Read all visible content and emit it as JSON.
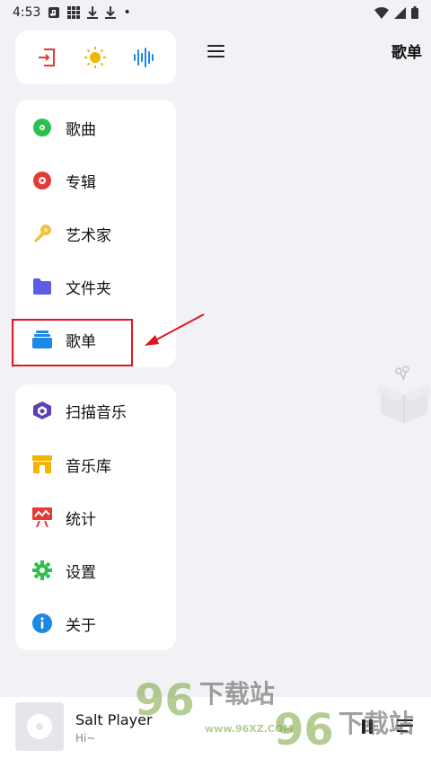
{
  "status_bar": {
    "time": "4:53",
    "dot": "•"
  },
  "quick_actions": [
    {
      "icon": "exit-icon",
      "color": "#e53935"
    },
    {
      "icon": "sun-icon",
      "color": "#f5b400"
    },
    {
      "icon": "waveform-icon",
      "color": "#1e88e5"
    }
  ],
  "nav_group_1": [
    {
      "label": "歌曲",
      "icon": "disc-green-icon",
      "color": "#2fbf4f"
    },
    {
      "label": "专辑",
      "icon": "album-red-icon",
      "color": "#e53935"
    },
    {
      "label": "艺术家",
      "icon": "microphone-icon",
      "color": "#f5c042"
    },
    {
      "label": "文件夹",
      "icon": "folder-icon",
      "color": "#5e5ce6"
    },
    {
      "label": "歌单",
      "icon": "playlist-stack-icon",
      "color": "#1e88e5"
    }
  ],
  "nav_group_2": [
    {
      "label": "扫描音乐",
      "icon": "scan-cube-icon",
      "color": "#5e3fb6"
    },
    {
      "label": "音乐库",
      "icon": "store-icon",
      "color": "#f5b400"
    },
    {
      "label": "统计",
      "icon": "chart-easel-icon",
      "color": "#e53935"
    },
    {
      "label": "设置",
      "icon": "gear-icon",
      "color": "#2fbf4f"
    },
    {
      "label": "关于",
      "icon": "info-icon",
      "color": "#1e88e5"
    }
  ],
  "header": {
    "title": "歌单"
  },
  "player": {
    "track_title": "Salt Player",
    "track_subtitle": "Hi~"
  },
  "watermark": {
    "number": "96",
    "brand": "下载站",
    "url": "www.96XZ.COM"
  },
  "colors": {
    "background": "#f2f2f6",
    "card": "#ffffff",
    "annotation": "#e0161e"
  }
}
